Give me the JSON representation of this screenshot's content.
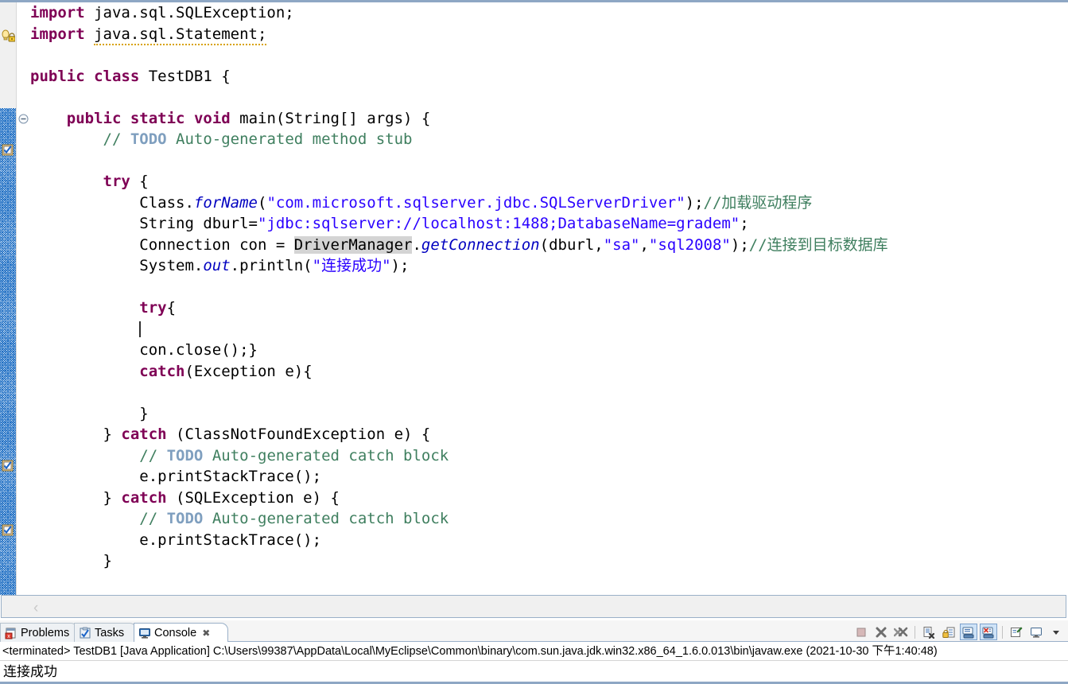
{
  "editor": {
    "name": "java-source-editor",
    "language": "Java",
    "class_name": "TestDB1",
    "current_line_index": 15,
    "colors": {
      "keyword": "#7f0055",
      "string": "#2a00ff",
      "comment": "#3f7f5f",
      "todo_tag": "#7f9fbf",
      "static_field": "#0000c0",
      "occurrence_highlight": "#d4d4d4",
      "current_line_highlight": "#e6eefa",
      "warning_underline": "#d8a200"
    },
    "gutter": {
      "warning_icon": "warning-quickfix-icon",
      "fold_marker": "collapse-fold-icon",
      "task_markers": [
        "task-checkbox-icon",
        "task-checkbox-icon",
        "task-checkbox-icon"
      ]
    },
    "lines": [
      {
        "tokens": [
          {
            "t": "import",
            "c": "kw"
          },
          {
            "t": " java.sql.SQLException;",
            "c": "plain"
          }
        ]
      },
      {
        "tokens": [
          {
            "t": "import",
            "c": "kw"
          },
          {
            "t": " ",
            "c": "plain"
          },
          {
            "t": "java.sql.Statement;",
            "c": "plain warn-underline"
          }
        ]
      },
      {
        "tokens": [
          {
            "t": "",
            "c": "plain"
          }
        ]
      },
      {
        "tokens": [
          {
            "t": "public",
            "c": "kw"
          },
          {
            "t": " ",
            "c": "plain"
          },
          {
            "t": "class",
            "c": "kw"
          },
          {
            "t": " TestDB1 {",
            "c": "plain"
          }
        ]
      },
      {
        "tokens": [
          {
            "t": "",
            "c": "plain"
          }
        ]
      },
      {
        "tokens": [
          {
            "t": "    ",
            "c": "plain"
          },
          {
            "t": "public",
            "c": "kw"
          },
          {
            "t": " ",
            "c": "plain"
          },
          {
            "t": "static",
            "c": "kw"
          },
          {
            "t": " ",
            "c": "plain"
          },
          {
            "t": "void",
            "c": "kw"
          },
          {
            "t": " main(String[] args) {",
            "c": "plain"
          }
        ]
      },
      {
        "tokens": [
          {
            "t": "        ",
            "c": "plain"
          },
          {
            "t": "// ",
            "c": "cmt"
          },
          {
            "t": "TODO",
            "c": "todo"
          },
          {
            "t": " Auto-generated method stub",
            "c": "cmt"
          }
        ]
      },
      {
        "tokens": [
          {
            "t": "",
            "c": "plain"
          }
        ]
      },
      {
        "tokens": [
          {
            "t": "        ",
            "c": "plain"
          },
          {
            "t": "try",
            "c": "kw"
          },
          {
            "t": " {",
            "c": "plain"
          }
        ]
      },
      {
        "tokens": [
          {
            "t": "            Class.",
            "c": "plain"
          },
          {
            "t": "forName",
            "c": "stat"
          },
          {
            "t": "(",
            "c": "plain"
          },
          {
            "t": "\"com.microsoft.sqlserver.jdbc.SQLServerDriver\"",
            "c": "str"
          },
          {
            "t": ");",
            "c": "plain"
          },
          {
            "t": "//加载驱动程序",
            "c": "cmt"
          }
        ]
      },
      {
        "tokens": [
          {
            "t": "            String dburl=",
            "c": "plain"
          },
          {
            "t": "\"jdbc:sqlserver://localhost:1488;DatabaseName=gradem\"",
            "c": "str"
          },
          {
            "t": ";",
            "c": "plain"
          }
        ]
      },
      {
        "tokens": [
          {
            "t": "            Connection con = ",
            "c": "plain"
          },
          {
            "t": "DriverManager",
            "c": "plain occ"
          },
          {
            "t": ".",
            "c": "plain"
          },
          {
            "t": "getConnection",
            "c": "stat"
          },
          {
            "t": "(dburl,",
            "c": "plain"
          },
          {
            "t": "\"sa\"",
            "c": "str"
          },
          {
            "t": ",",
            "c": "plain"
          },
          {
            "t": "\"sql2008\"",
            "c": "str"
          },
          {
            "t": ");",
            "c": "plain"
          },
          {
            "t": "//连接到目标数据库",
            "c": "cmt"
          }
        ]
      },
      {
        "tokens": [
          {
            "t": "            System.",
            "c": "plain"
          },
          {
            "t": "out",
            "c": "fld"
          },
          {
            "t": ".println(",
            "c": "plain"
          },
          {
            "t": "\"连接成功\"",
            "c": "str"
          },
          {
            "t": ");",
            "c": "plain"
          }
        ]
      },
      {
        "tokens": [
          {
            "t": "",
            "c": "plain"
          }
        ]
      },
      {
        "tokens": [
          {
            "t": "            ",
            "c": "plain"
          },
          {
            "t": "try",
            "c": "kw"
          },
          {
            "t": "{",
            "c": "plain"
          }
        ]
      },
      {
        "tokens": [
          {
            "t": "            ",
            "c": "plain"
          },
          {
            "t": "|CARET|",
            "c": "caret"
          }
        ]
      },
      {
        "tokens": [
          {
            "t": "            con.close();}",
            "c": "plain"
          }
        ]
      },
      {
        "tokens": [
          {
            "t": "            ",
            "c": "plain"
          },
          {
            "t": "catch",
            "c": "kw"
          },
          {
            "t": "(Exception e){",
            "c": "plain"
          }
        ]
      },
      {
        "tokens": [
          {
            "t": "",
            "c": "plain"
          }
        ]
      },
      {
        "tokens": [
          {
            "t": "            }",
            "c": "plain"
          }
        ]
      },
      {
        "tokens": [
          {
            "t": "        } ",
            "c": "plain"
          },
          {
            "t": "catch",
            "c": "kw"
          },
          {
            "t": " (ClassNotFoundException e) {",
            "c": "plain"
          }
        ]
      },
      {
        "tokens": [
          {
            "t": "            ",
            "c": "plain"
          },
          {
            "t": "// ",
            "c": "cmt"
          },
          {
            "t": "TODO",
            "c": "todo"
          },
          {
            "t": " Auto-generated catch block",
            "c": "cmt"
          }
        ]
      },
      {
        "tokens": [
          {
            "t": "            e.printStackTrace();",
            "c": "plain"
          }
        ]
      },
      {
        "tokens": [
          {
            "t": "        } ",
            "c": "plain"
          },
          {
            "t": "catch",
            "c": "kw"
          },
          {
            "t": " (SQLException e) {",
            "c": "plain"
          }
        ]
      },
      {
        "tokens": [
          {
            "t": "            ",
            "c": "plain"
          },
          {
            "t": "// ",
            "c": "cmt"
          },
          {
            "t": "TODO",
            "c": "todo"
          },
          {
            "t": " Auto-generated catch block",
            "c": "cmt"
          }
        ]
      },
      {
        "tokens": [
          {
            "t": "            e.printStackTrace();",
            "c": "plain"
          }
        ]
      },
      {
        "tokens": [
          {
            "t": "        }",
            "c": "plain"
          }
        ]
      }
    ],
    "hscroll": {
      "left_chevron": "‹"
    }
  },
  "bottom_panel": {
    "tabs": [
      {
        "label": "Problems",
        "icon": "problems-icon",
        "active": false,
        "closable": false
      },
      {
        "label": "Tasks",
        "icon": "tasks-icon",
        "active": false,
        "closable": false
      },
      {
        "label": "Console",
        "icon": "console-icon",
        "active": true,
        "closable": true,
        "close_glyph": "✖"
      }
    ],
    "toolbar": [
      {
        "name": "terminate-button",
        "icon": "stop-square-icon",
        "toggled": false
      },
      {
        "name": "remove-launch-button",
        "icon": "remove-x-icon",
        "toggled": false
      },
      {
        "name": "remove-all-launches-button",
        "icon": "remove-all-xx-icon",
        "toggled": false
      },
      {
        "name": "separator-1",
        "icon": "separator",
        "toggled": false
      },
      {
        "name": "clear-console-button",
        "icon": "clear-console-icon",
        "toggled": false
      },
      {
        "name": "scroll-lock-button",
        "icon": "scroll-lock-icon",
        "toggled": false
      },
      {
        "name": "show-console-on-output-button",
        "icon": "console-output-icon",
        "toggled": true
      },
      {
        "name": "show-console-on-error-button",
        "icon": "console-error-icon",
        "toggled": true
      },
      {
        "name": "separator-2",
        "icon": "separator",
        "toggled": false
      },
      {
        "name": "pin-console-button",
        "icon": "pin-console-icon",
        "toggled": false
      },
      {
        "name": "display-selected-console-button",
        "icon": "display-console-icon",
        "toggled": false
      },
      {
        "name": "view-menu-button",
        "icon": "chevron-down-icon",
        "toggled": false
      }
    ],
    "console": {
      "process_line": "<terminated> TestDB1 [Java Application] C:\\Users\\99387\\AppData\\Local\\MyEclipse\\Common\\binary\\com.sun.java.jdk.win32.x86_64_1.6.0.013\\bin\\javaw.exe (2021-10-30 下午1:40:48)",
      "output": "连接成功"
    }
  }
}
